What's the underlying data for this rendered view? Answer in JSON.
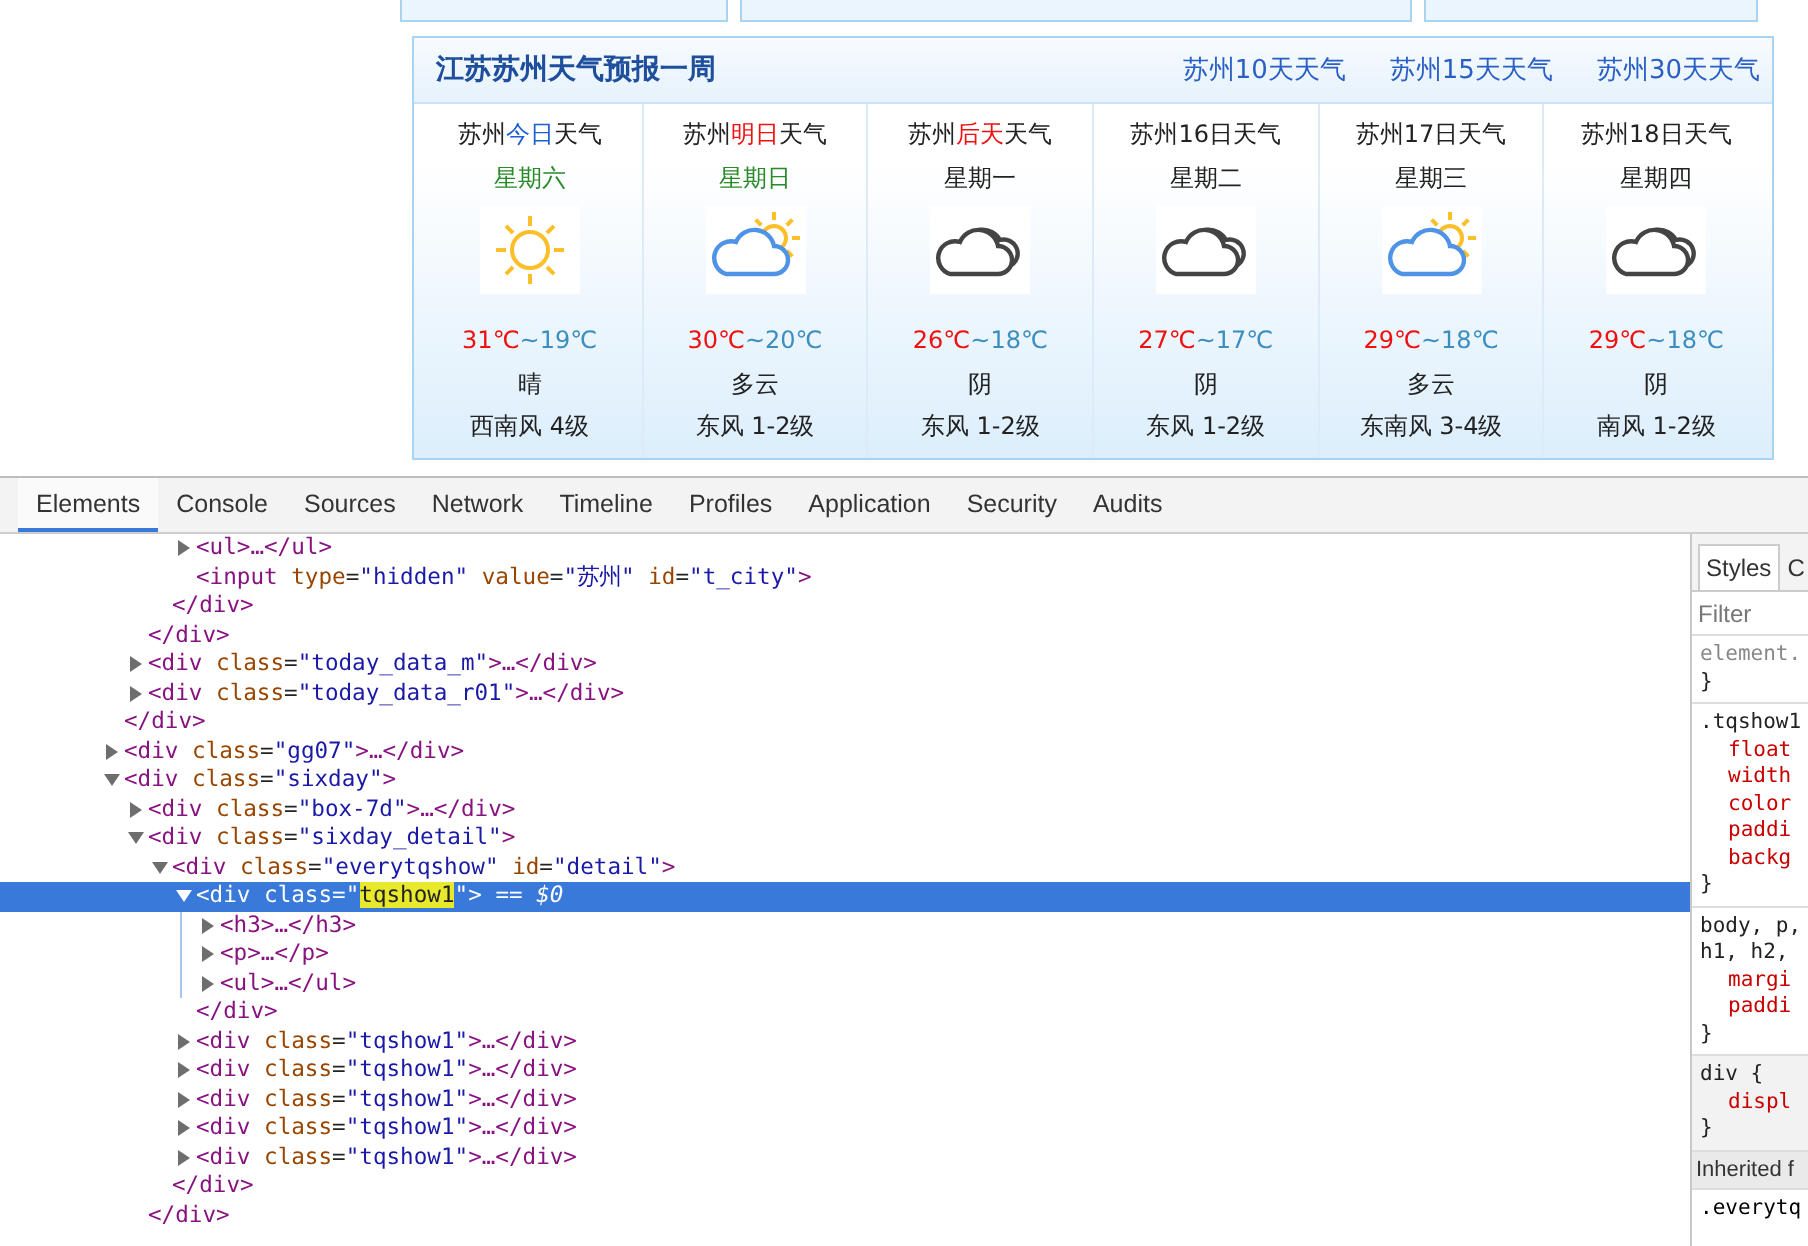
{
  "page": {
    "forecast": {
      "title": "江苏苏州天气预报一周",
      "links": [
        "苏州10天天气",
        "苏州15天天气",
        "苏州30天天气"
      ],
      "days": [
        {
          "city": "苏州",
          "day": {
            "text": "今日",
            "color": "#1e5fcf"
          },
          "tail": "天气",
          "weekday": {
            "text": "星期六",
            "color": "#2a8a2a"
          },
          "kind": "sunny",
          "high": "31℃",
          "sep": "~",
          "low": "19℃",
          "condition": "晴",
          "wind": "西南风 4级"
        },
        {
          "city": "苏州",
          "day": {
            "text": "明日",
            "color": "#ee1111"
          },
          "tail": "天气",
          "weekday": {
            "text": "星期日",
            "color": "#2a8a2a"
          },
          "kind": "partly_cloudy",
          "high": "30℃",
          "sep": "~",
          "low": "20℃",
          "condition": "多云",
          "wind": "东风 1-2级"
        },
        {
          "city": "苏州",
          "day": {
            "text": "后天",
            "color": "#ee1111"
          },
          "tail": "天气",
          "weekday": {
            "text": "星期一",
            "color": "#222222"
          },
          "kind": "cloudy",
          "high": "26℃",
          "sep": "~",
          "low": "18℃",
          "condition": "阴",
          "wind": "东风 1-2级"
        },
        {
          "city": "苏州",
          "day": {
            "text": "16日",
            "color": "#222222"
          },
          "tail": "天气",
          "weekday": {
            "text": "星期二",
            "color": "#222222"
          },
          "kind": "cloudy",
          "high": "27℃",
          "sep": "~",
          "low": "17℃",
          "condition": "阴",
          "wind": "东风 1-2级"
        },
        {
          "city": "苏州",
          "day": {
            "text": "17日",
            "color": "#222222"
          },
          "tail": "天气",
          "weekday": {
            "text": "星期三",
            "color": "#222222"
          },
          "kind": "partly_cloudy",
          "high": "29℃",
          "sep": "~",
          "low": "18℃",
          "condition": "多云",
          "wind": "东南风 3-4级"
        },
        {
          "city": "苏州",
          "day": {
            "text": "18日",
            "color": "#222222"
          },
          "tail": "天气",
          "weekday": {
            "text": "星期四",
            "color": "#222222"
          },
          "kind": "cloudy",
          "high": "29℃",
          "sep": "~",
          "low": "18℃",
          "condition": "阴",
          "wind": "南风 1-2级"
        }
      ]
    }
  },
  "devtools": {
    "tabs": [
      {
        "label": "Elements",
        "selected": true
      },
      {
        "label": "Console",
        "selected": false
      },
      {
        "label": "Sources",
        "selected": false
      },
      {
        "label": "Network",
        "selected": false
      },
      {
        "label": "Timeline",
        "selected": false
      },
      {
        "label": "Profiles",
        "selected": false
      },
      {
        "label": "Application",
        "selected": false
      },
      {
        "label": "Security",
        "selected": false
      },
      {
        "label": "Audits",
        "selected": false
      }
    ],
    "tree": [
      {
        "children": [
          {
            "children": [
              {
                "children": [
                  {
                    "selected": false,
                    "expanded": false,
                    "tokens": [
                      {
                        "kind": "tag",
                        "text": "<ul>…</ul>"
                      }
                    ]
                  },
                  {
                    "selected": false,
                    "tokens": [
                      {
                        "kind": "tag",
                        "text": "<input"
                      },
                      {
                        "kind": "attr",
                        "text": " type"
                      },
                      {
                        "kind": "punct",
                        "text": "="
                      },
                      {
                        "kind": "value",
                        "text": "\"hidden\""
                      },
                      {
                        "kind": "attr",
                        "text": " value"
                      },
                      {
                        "kind": "punct",
                        "text": "="
                      },
                      {
                        "kind": "value",
                        "text": "\"苏州\""
                      },
                      {
                        "kind": "attr",
                        "text": " id"
                      },
                      {
                        "kind": "punct",
                        "text": "="
                      },
                      {
                        "kind": "value",
                        "text": "\"t_city\""
                      },
                      {
                        "kind": "tag",
                        "text": ">"
                      }
                    ]
                  }
                ]
              },
              {
                "selected": false,
                "tokens": [
                  {
                    "kind": "tag",
                    "text": "</div>"
                  }
                ]
              }
            ]
          },
          {
            "selected": false,
            "tokens": [
              {
                "kind": "tag",
                "text": "</div>"
              }
            ]
          },
          {
            "selected": false,
            "expanded": false,
            "tokens": [
              {
                "kind": "tag",
                "text": "<div"
              },
              {
                "kind": "attr",
                "text": " class"
              },
              {
                "kind": "punct",
                "text": "="
              },
              {
                "kind": "value",
                "text": "\"today_data_m\""
              },
              {
                "kind": "tag",
                "text": ">…</div>"
              }
            ]
          },
          {
            "selected": false,
            "expanded": false,
            "tokens": [
              {
                "kind": "tag",
                "text": "<div"
              },
              {
                "kind": "attr",
                "text": " class"
              },
              {
                "kind": "punct",
                "text": "="
              },
              {
                "kind": "value",
                "text": "\"today_data_r01\""
              },
              {
                "kind": "tag",
                "text": ">…</div>"
              }
            ]
          }
        ]
      },
      {
        "selected": false,
        "tokens": [
          {
            "kind": "tag",
            "text": "</div>"
          }
        ]
      },
      {
        "selected": false,
        "expanded": false,
        "tokens": [
          {
            "kind": "tag",
            "text": "<div"
          },
          {
            "kind": "attr",
            "text": " class"
          },
          {
            "kind": "punct",
            "text": "="
          },
          {
            "kind": "value",
            "text": "\"gg07\""
          },
          {
            "kind": "tag",
            "text": ">…</div>"
          }
        ]
      },
      {
        "selected": false,
        "expanded": true,
        "tokens": [
          {
            "kind": "tag",
            "text": "<div"
          },
          {
            "kind": "attr",
            "text": " class"
          },
          {
            "kind": "punct",
            "text": "="
          },
          {
            "kind": "value",
            "text": "\"sixday\""
          },
          {
            "kind": "tag",
            "text": ">"
          }
        ],
        "children": [
          {
            "selected": false,
            "expanded": false,
            "tokens": [
              {
                "kind": "tag",
                "text": "<div"
              },
              {
                "kind": "attr",
                "text": " class"
              },
              {
                "kind": "punct",
                "text": "="
              },
              {
                "kind": "value",
                "text": "\"box-7d\""
              },
              {
                "kind": "tag",
                "text": ">…</div>"
              }
            ]
          },
          {
            "selected": false,
            "expanded": true,
            "tokens": [
              {
                "kind": "tag",
                "text": "<div"
              },
              {
                "kind": "attr",
                "text": " class"
              },
              {
                "kind": "punct",
                "text": "="
              },
              {
                "kind": "value",
                "text": "\"sixday_detail\""
              },
              {
                "kind": "tag",
                "text": ">"
              }
            ],
            "children": [
              {
                "selected": false,
                "expanded": true,
                "tokens": [
                  {
                    "kind": "tag",
                    "text": "<div"
                  },
                  {
                    "kind": "attr",
                    "text": " class"
                  },
                  {
                    "kind": "punct",
                    "text": "="
                  },
                  {
                    "kind": "value",
                    "text": "\"everytqshow\""
                  },
                  {
                    "kind": "attr",
                    "text": " id"
                  },
                  {
                    "kind": "punct",
                    "text": "="
                  },
                  {
                    "kind": "value",
                    "text": "\"detail\""
                  },
                  {
                    "kind": "tag",
                    "text": ">"
                  }
                ],
                "children": [
                  {
                    "selected": true,
                    "expanded": true,
                    "tokens": [
                      {
                        "kind": "tag",
                        "text": "<div"
                      },
                      {
                        "kind": "attr",
                        "text": " class"
                      },
                      {
                        "kind": "punct",
                        "text": "="
                      },
                      {
                        "kind": "value",
                        "text": "\""
                      },
                      {
                        "kind": "match",
                        "text": "tqshow1"
                      },
                      {
                        "kind": "value",
                        "text": "\""
                      },
                      {
                        "kind": "tag",
                        "text": ">"
                      },
                      {
                        "kind": "ref",
                        "text": " == $0"
                      }
                    ],
                    "children": [
                      {
                        "selected": false,
                        "expanded": false,
                        "tokens": [
                          {
                            "kind": "tag",
                            "text": "<h3>…</h3>"
                          }
                        ]
                      },
                      {
                        "selected": false,
                        "expanded": false,
                        "tokens": [
                          {
                            "kind": "tag",
                            "text": "<p>…</p>"
                          }
                        ]
                      },
                      {
                        "selected": false,
                        "expanded": false,
                        "tokens": [
                          {
                            "kind": "tag",
                            "text": "<ul>…</ul>"
                          }
                        ]
                      }
                    ]
                  },
                  {
                    "selected": false,
                    "tokens": [
                      {
                        "kind": "tag",
                        "text": "</div>"
                      }
                    ]
                  },
                  {
                    "selected": false,
                    "expanded": false,
                    "tokens": [
                      {
                        "kind": "tag",
                        "text": "<div"
                      },
                      {
                        "kind": "attr",
                        "text": " class"
                      },
                      {
                        "kind": "punct",
                        "text": "="
                      },
                      {
                        "kind": "value",
                        "text": "\"tqshow1\""
                      },
                      {
                        "kind": "tag",
                        "text": ">…</div>"
                      }
                    ]
                  },
                  {
                    "selected": false,
                    "expanded": false,
                    "tokens": [
                      {
                        "kind": "tag",
                        "text": "<div"
                      },
                      {
                        "kind": "attr",
                        "text": " class"
                      },
                      {
                        "kind": "punct",
                        "text": "="
                      },
                      {
                        "kind": "value",
                        "text": "\"tqshow1\""
                      },
                      {
                        "kind": "tag",
                        "text": ">…</div>"
                      }
                    ]
                  },
                  {
                    "selected": false,
                    "expanded": false,
                    "tokens": [
                      {
                        "kind": "tag",
                        "text": "<div"
                      },
                      {
                        "kind": "attr",
                        "text": " class"
                      },
                      {
                        "kind": "punct",
                        "text": "="
                      },
                      {
                        "kind": "value",
                        "text": "\"tqshow1\""
                      },
                      {
                        "kind": "tag",
                        "text": ">…</div>"
                      }
                    ]
                  },
                  {
                    "selected": false,
                    "expanded": false,
                    "tokens": [
                      {
                        "kind": "tag",
                        "text": "<div"
                      },
                      {
                        "kind": "attr",
                        "text": " class"
                      },
                      {
                        "kind": "punct",
                        "text": "="
                      },
                      {
                        "kind": "value",
                        "text": "\"tqshow1\""
                      },
                      {
                        "kind": "tag",
                        "text": ">…</div>"
                      }
                    ]
                  },
                  {
                    "selected": false,
                    "expanded": false,
                    "tokens": [
                      {
                        "kind": "tag",
                        "text": "<div"
                      },
                      {
                        "kind": "attr",
                        "text": " class"
                      },
                      {
                        "kind": "punct",
                        "text": "="
                      },
                      {
                        "kind": "value",
                        "text": "\"tqshow1\""
                      },
                      {
                        "kind": "tag",
                        "text": ">…</div>"
                      }
                    ]
                  }
                ]
              },
              {
                "selected": false,
                "tokens": [
                  {
                    "kind": "tag",
                    "text": "</div>"
                  }
                ]
              }
            ]
          },
          {
            "selected": false,
            "tokens": [
              {
                "kind": "tag",
                "text": "</div>"
              }
            ]
          }
        ]
      }
    ],
    "styles_pane": {
      "tabs": [
        {
          "label": "Styles",
          "selected": true
        },
        {
          "label": "C",
          "selected": false
        }
      ],
      "filter_placeholder": "Filter",
      "rules": [
        {
          "kind": "inline",
          "selector": [
            "element."
          ],
          "close": "}"
        },
        {
          "kind": "author",
          "selector": [
            ".tqshow1"
          ],
          "properties": [
            "float",
            "width",
            "color",
            "paddi",
            "backg"
          ],
          "close": "}"
        },
        {
          "kind": "author",
          "selector": [
            "body, p,",
            "h1, h2,"
          ],
          "properties": [
            "margi",
            "paddi"
          ],
          "close": "}"
        },
        {
          "kind": "user-agent",
          "selector": [
            "div {"
          ],
          "properties": [
            "displ"
          ],
          "close": "}"
        }
      ],
      "inherited": "Inherited f",
      "next_selector": ".everytq"
    }
  }
}
